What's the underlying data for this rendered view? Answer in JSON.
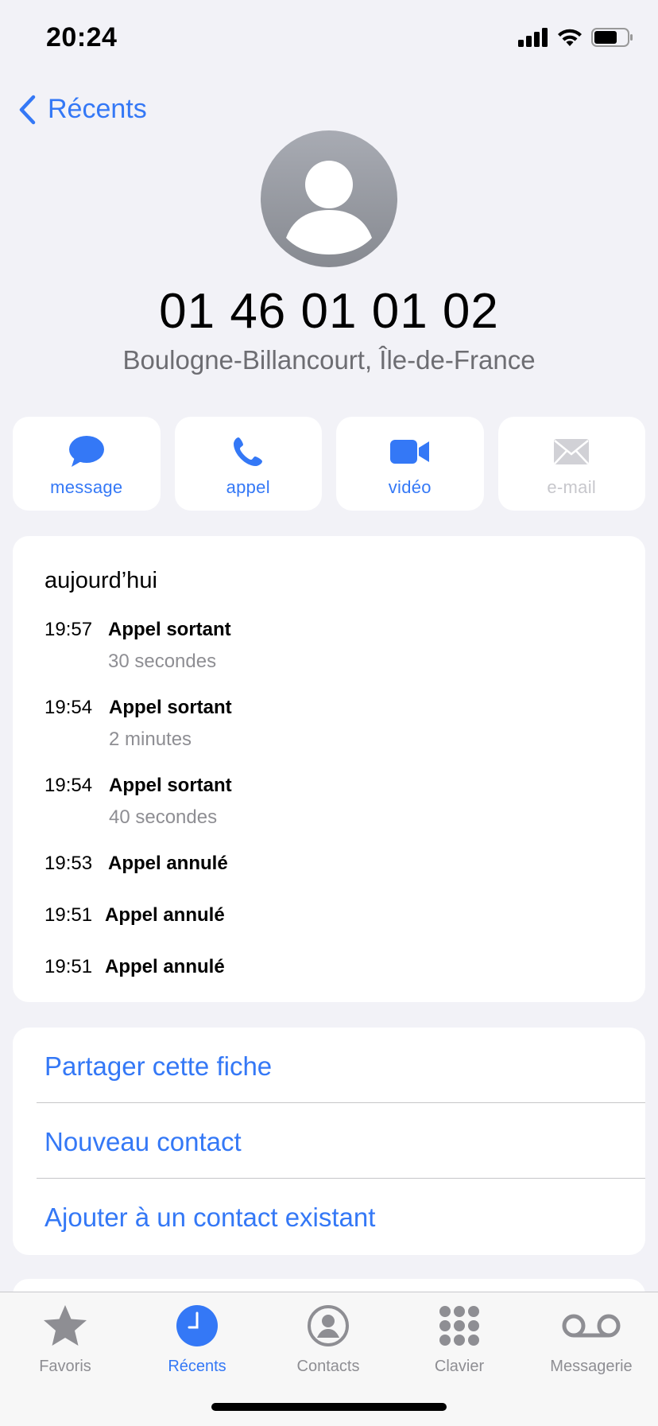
{
  "status_bar": {
    "time": "20:24"
  },
  "nav": {
    "back_label": "Récents"
  },
  "contact": {
    "phone_number": "01 46 01 01 02",
    "location": "Boulogne-Billancourt, Île-de-France"
  },
  "actions": [
    {
      "label": "message",
      "icon": "message-bubble-icon",
      "enabled": true
    },
    {
      "label": "appel",
      "icon": "phone-icon",
      "enabled": true
    },
    {
      "label": "vidéo",
      "icon": "video-camera-icon",
      "enabled": true
    },
    {
      "label": "e-mail",
      "icon": "envelope-icon",
      "enabled": false
    }
  ],
  "calls": {
    "header": "aujourd’hui",
    "entries": [
      {
        "time": "19:57",
        "type": "Appel sortant",
        "duration": "30 secondes"
      },
      {
        "time": "19:54",
        "type": "Appel sortant",
        "duration": "2 minutes"
      },
      {
        "time": "19:54",
        "type": "Appel sortant",
        "duration": "40 secondes"
      },
      {
        "time": "19:53",
        "type": "Appel annulé",
        "duration": ""
      },
      {
        "time": "19:51",
        "type": "Appel annulé",
        "duration": ""
      },
      {
        "time": "19:51",
        "type": "Appel annulé",
        "duration": ""
      }
    ]
  },
  "options": [
    "Partager cette fiche",
    "Nouveau contact",
    "Ajouter à un contact existant"
  ],
  "tabbar": [
    {
      "label": "Favoris",
      "icon": "star-icon",
      "active": false
    },
    {
      "label": "Récents",
      "icon": "clock-icon",
      "active": true
    },
    {
      "label": "Contacts",
      "icon": "person-circle-icon",
      "active": false
    },
    {
      "label": "Clavier",
      "icon": "keypad-icon",
      "active": false
    },
    {
      "label": "Messagerie",
      "icon": "voicemail-icon",
      "active": false
    }
  ],
  "colors": {
    "accent": "#3478f6",
    "background": "#f2f2f7",
    "secondary_text": "#8e8e93"
  }
}
